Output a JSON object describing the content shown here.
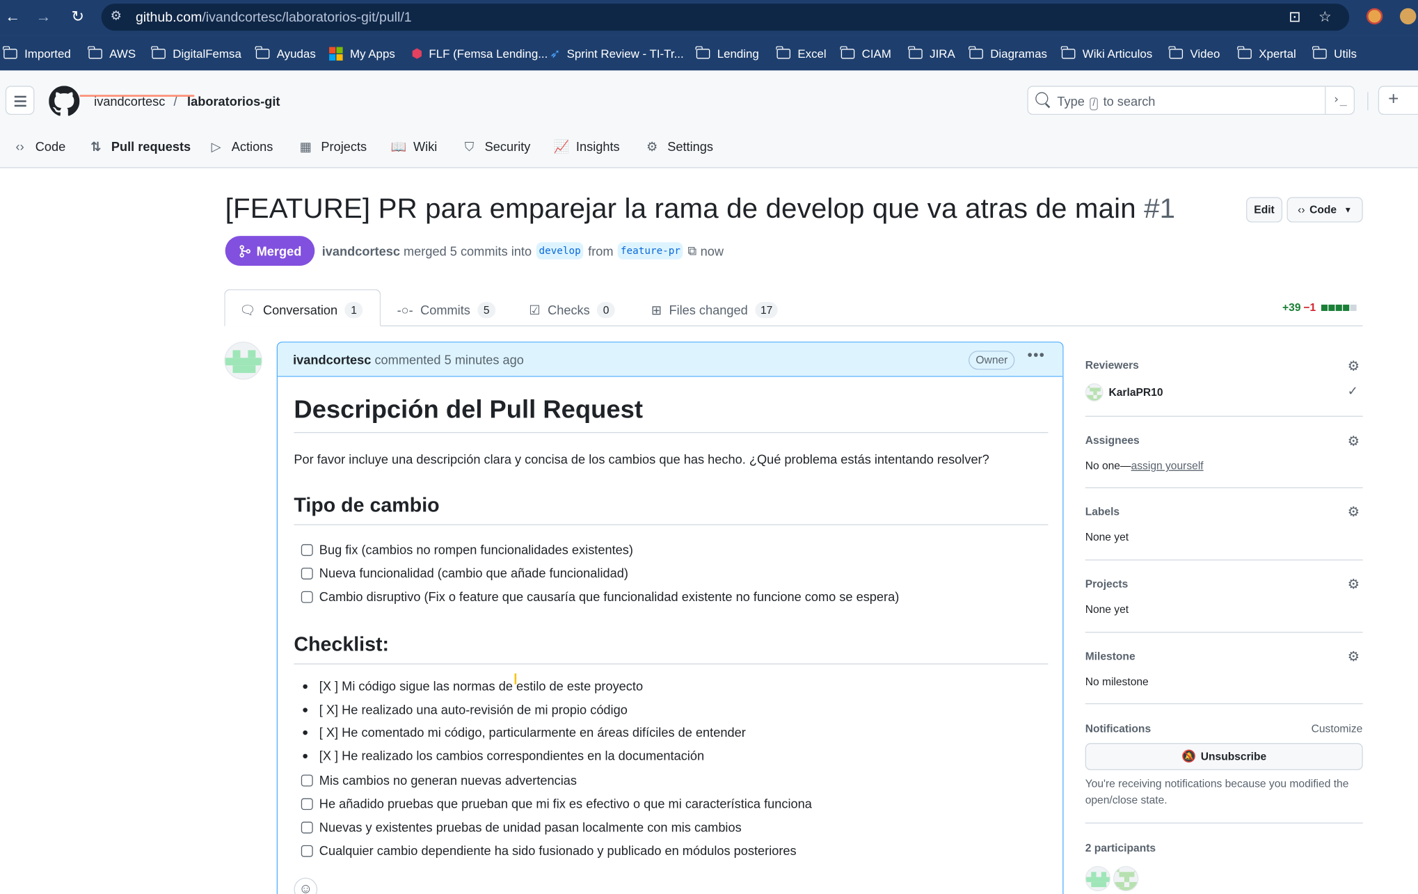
{
  "browser": {
    "url_host": "github.com",
    "url_path": "/ivandcortesc/laboratorios-git/pull/1",
    "bookmarks": [
      {
        "label": "Imported",
        "icon": "folder-icon"
      },
      {
        "label": "AWS",
        "icon": "folder-icon"
      },
      {
        "label": "DigitalFemsa",
        "icon": "folder-icon"
      },
      {
        "label": "Ayudas",
        "icon": "folder-icon"
      },
      {
        "label": "My Apps",
        "icon": "microsoft-icon"
      },
      {
        "label": "FLF (Femsa Lending...",
        "icon": "flf-icon"
      },
      {
        "label": "Sprint Review - TI-Tr...",
        "icon": "sprint-icon"
      },
      {
        "label": "Lending",
        "icon": "folder-icon"
      },
      {
        "label": "Excel",
        "icon": "folder-icon"
      },
      {
        "label": "CIAM",
        "icon": "folder-icon"
      },
      {
        "label": "JIRA",
        "icon": "folder-icon"
      },
      {
        "label": "Diagramas",
        "icon": "folder-icon"
      },
      {
        "label": "Wiki Articulos",
        "icon": "folder-icon"
      },
      {
        "label": "Video",
        "icon": "folder-icon"
      },
      {
        "label": "Xpertal",
        "icon": "folder-icon"
      },
      {
        "label": "Utils",
        "icon": "folder-icon"
      }
    ]
  },
  "header": {
    "owner": "ivandcortesc",
    "separator": "/",
    "repo": "laboratorios-git",
    "search_prefix": "Type",
    "search_key": "/",
    "search_suffix": "to search",
    "cmd_glyph": "›_",
    "plus_glyph": "+"
  },
  "repo_nav": [
    {
      "label": "Code",
      "icon": "code-icon",
      "glyph": "‹›"
    },
    {
      "label": "Pull requests",
      "icon": "pull-request-icon",
      "glyph": "⇅"
    },
    {
      "label": "Actions",
      "icon": "play-icon",
      "glyph": "▷"
    },
    {
      "label": "Projects",
      "icon": "table-icon",
      "glyph": "▦"
    },
    {
      "label": "Wiki",
      "icon": "book-icon",
      "glyph": "📖"
    },
    {
      "label": "Security",
      "icon": "shield-icon",
      "glyph": "⛉"
    },
    {
      "label": "Insights",
      "icon": "graph-icon",
      "glyph": "📈"
    },
    {
      "label": "Settings",
      "icon": "gear-icon",
      "glyph": "⚙"
    }
  ],
  "pr": {
    "title": "[FEATURE] PR para emparejar la rama de develop que va atras de main",
    "number": "#1",
    "edit_label": "Edit",
    "code_label": "Code",
    "state": "Merged",
    "author": "ivandcortesc",
    "merged_text": "merged 5 commits into",
    "base_branch": "develop",
    "from_text": "from",
    "head_branch": "feature-pr",
    "time": "now"
  },
  "tabs": [
    {
      "label": "Conversation",
      "count": "1"
    },
    {
      "label": "Commits",
      "count": "5"
    },
    {
      "label": "Checks",
      "count": "0"
    },
    {
      "label": "Files changed",
      "count": "17"
    }
  ],
  "diffstat": {
    "additions": "+39",
    "deletions": "−1",
    "colors": [
      "#1a7f37",
      "#1a7f37",
      "#1a7f37",
      "#1a7f37",
      "#d0d7de"
    ]
  },
  "comment": {
    "author": "ivandcortesc",
    "action": "commented",
    "time": "5 minutes ago",
    "role": "Owner",
    "h1": "Descripción del Pull Request",
    "intro": "Por favor incluye una descripción clara y concisa de los cambios que has hecho. ¿Qué problema estás intentando resolver?",
    "h2_type": "Tipo de cambio",
    "type_tasks": [
      "Bug fix (cambios no rompen funcionalidades existentes)",
      "Nueva funcionalidad (cambio que añade funcionalidad)",
      "Cambio disruptivo (Fix o feature que causaría que funcionalidad existente no funcione como se espera)"
    ],
    "h2_checklist": "Checklist:",
    "bullets": [
      "[X ] Mi código sigue las normas de estilo de este proyecto",
      "[ X] He realizado una auto-revisión de mi propio código",
      "[ X] He comentado mi código, particularmente en áreas difíciles de entender",
      "[X ] He realizado los cambios correspondientes en la documentación"
    ],
    "checklist_tasks": [
      "Mis cambios no generan nuevas advertencias",
      "He añadido pruebas que prueban que mi fix es efectivo o que mi característica funciona",
      "Nuevas y existentes pruebas de unidad pasan localmente con mis cambios",
      "Cualquier cambio dependiente ha sido fusionado y publicado en módulos posteriores"
    ]
  },
  "sidebar": {
    "reviewers_title": "Reviewers",
    "reviewer": "KarlaPR10",
    "assignees_title": "Assignees",
    "assignees_none": "No one—",
    "assign_yourself": "assign yourself",
    "labels_title": "Labels",
    "labels_value": "None yet",
    "projects_title": "Projects",
    "projects_value": "None yet",
    "milestone_title": "Milestone",
    "milestone_value": "No milestone",
    "notifications_title": "Notifications",
    "customize": "Customize",
    "unsubscribe": "Unsubscribe",
    "notif_line1": "You're receiving notifications because you modified the",
    "notif_line2": "open/close state.",
    "participants": "2 participants"
  }
}
